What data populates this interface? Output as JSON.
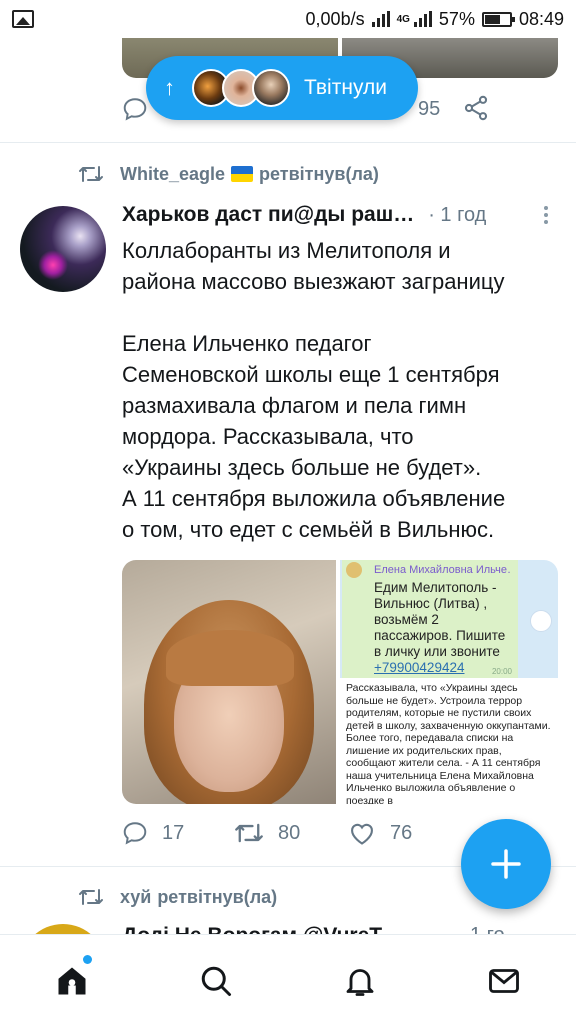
{
  "status_bar": {
    "speed": "0,00b/s",
    "network": "4G",
    "battery": "57%",
    "time": "08:49"
  },
  "top_tweet": {
    "share_count_partial": "95"
  },
  "tweeted_pill": {
    "label": "Твітнули"
  },
  "retweet_1": {
    "user": "White_eagle",
    "suffix": "ретвітнув(ла)"
  },
  "tweet": {
    "author_name": "Харьков даст пи@ды раш…",
    "time": "· 1 год",
    "lines": [
      "Коллаборанты из Мелитополя и",
      "района массово выезжают заграницу",
      "",
      "Елена Ильченко педагог",
      "Семеновской школы еще 1 сентября",
      "размахивала флагом и пела гимн",
      "мордора. Рассказывала, что",
      "«Украины здесь больше не будет».",
      "А 11 сентября выложила объявление",
      "о том, что едет с семьёй в Вильнюс."
    ],
    "screenshot": {
      "sender": "Елена Михайловна Ильче…",
      "message": "Едим Мелитополь - Вильнюс (Литва) , возьмём 2 пассажиров. Пишите в личку или звоните",
      "phone": "+79900429424",
      "msg_time": "20:00",
      "article": "Рассказывала, что «Украины здесь больше не будет». Устроила террор родителям, которые не пустили своих детей в школу, захваченную оккупантами. Более того, передавала списки на лишение их родительских прав, сообщают жители села. - А 11 сентября наша учительница Елена Михайловна Ильченко выложила объявление о поездке в"
    },
    "replies": "17",
    "retweets": "80",
    "likes": "76"
  },
  "retweet_2": {
    "user": "хуй",
    "suffix": "ретвітнув(ла)"
  },
  "next_tweet": {
    "author_partial": "Додi Не Ворогам @VureT…",
    "time_partial": "1 го"
  },
  "icons": {
    "reply": "reply-icon",
    "retweet": "retweet-icon",
    "like": "heart-icon",
    "share": "share-icon",
    "compose": "plus-icon",
    "home": "home-icon",
    "search": "search-icon",
    "notifications": "bell-icon",
    "messages": "mail-icon"
  },
  "colors": {
    "accent": "#1da1f2",
    "secondary_text": "#657786"
  }
}
